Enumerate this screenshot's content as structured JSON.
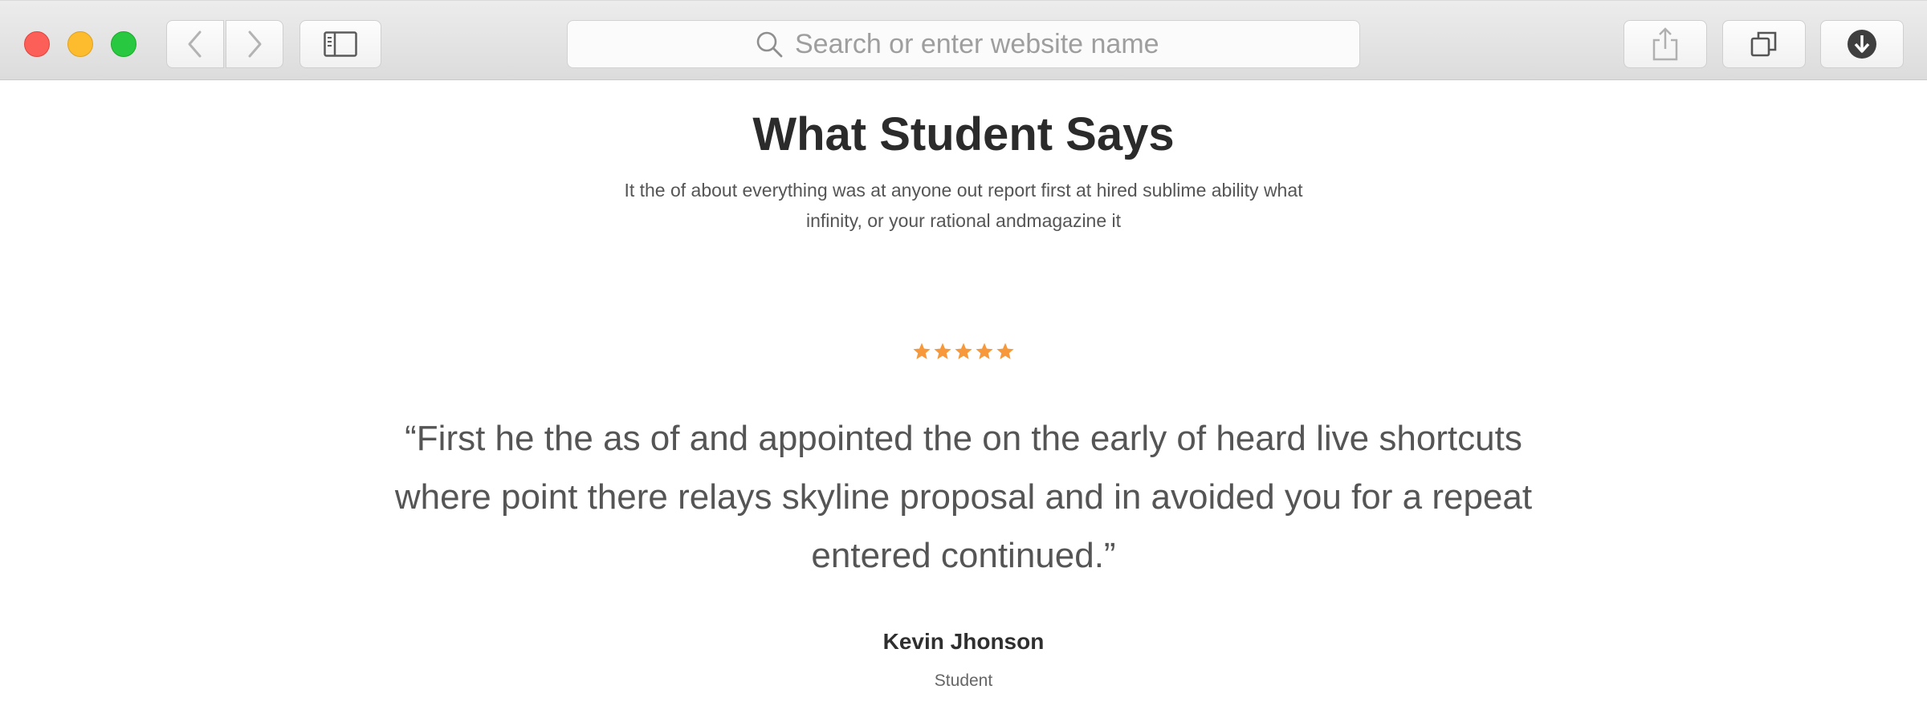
{
  "browser": {
    "search_placeholder": "Search or enter website name",
    "icons": {
      "back": "chevron-left-icon",
      "forward": "chevron-right-icon",
      "sidebar": "sidebar-icon",
      "search": "search-icon",
      "share": "share-icon",
      "tabs": "tabs-icon",
      "download": "download-icon"
    },
    "traffic_lights": {
      "close": "#fc5f57",
      "minimize": "#fdbc2e",
      "maximize": "#28c940"
    }
  },
  "testimonial": {
    "heading": "What Student Says",
    "subtext": "It the of about everything was at anyone out report first at hired sublime ability what infinity, or your rational andmagazine it",
    "rating": 5,
    "rating_max": 5,
    "star_color": "#f7993a",
    "quote": "“First he the as of and appointed the on the early of heard live shortcuts where point there relays skyline proposal and in avoided you for a repeat entered continued.”",
    "author_name": "Kevin Jhonson",
    "author_role": "Student"
  }
}
